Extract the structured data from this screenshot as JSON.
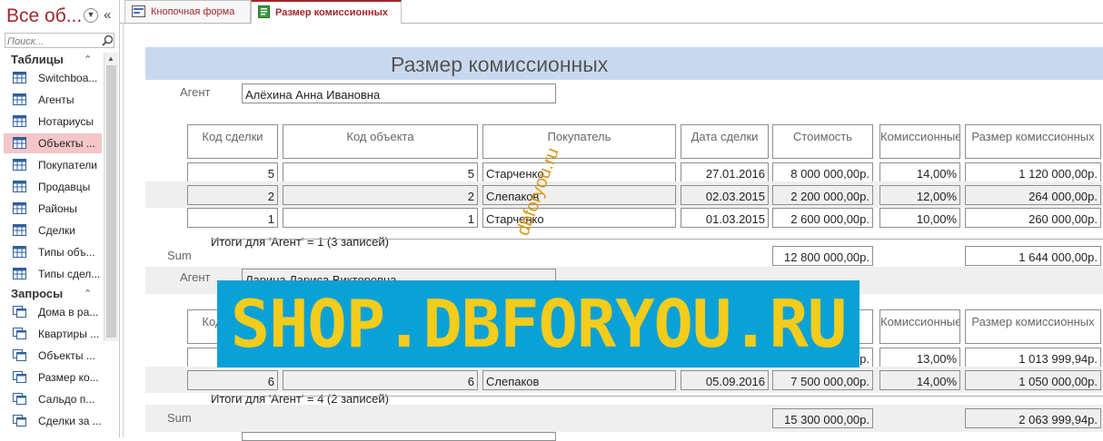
{
  "nav": {
    "title": "Все об...",
    "search_placeholder": "Поиск...",
    "sections": [
      {
        "label": "Таблицы",
        "items": [
          "Switchboa...",
          "Агенты",
          "Нотариусы",
          "Объекты ...",
          "Покупатели",
          "Продавцы",
          "Районы",
          "Сделки",
          "Типы объ...",
          "Типы сдел..."
        ]
      },
      {
        "label": "Запросы",
        "items": [
          "Дома в ра...",
          "Квартиры ...",
          "Объекты ...",
          "Размер ко...",
          "Сальдо п...",
          "Сделки за ..."
        ]
      }
    ],
    "selected_item": "Объекты ..."
  },
  "tabs": [
    {
      "label": "Кнопочная форма"
    },
    {
      "label": "Размер комиссионных"
    }
  ],
  "report": {
    "title": "Размер комиссионных",
    "agent_label": "Агент",
    "columns": [
      "Код сделки",
      "Код объекта",
      "Покупатель",
      "Дата сделки",
      "Стоимость",
      "Комиссионные",
      "Размер комиссионных"
    ],
    "sum_label": "Sum",
    "groups": [
      {
        "agent": "Алёхина Анна Ивановна",
        "rows": [
          [
            "5",
            "5",
            "Старченко",
            "27.01.2016",
            "8 000 000,00р.",
            "14,00%",
            "1 120 000,00р."
          ],
          [
            "2",
            "2",
            "Слепаков",
            "02.03.2015",
            "2 200 000,00р.",
            "12,00%",
            "264 000,00р."
          ],
          [
            "1",
            "1",
            "Старченко",
            "01.03.2015",
            "2 600 000,00р.",
            "10,00%",
            "260 000,00р."
          ]
        ],
        "totals_text": "Итоги для 'Агент' = 1 (3 записей)",
        "sum_cost": "12 800 000,00р.",
        "sum_commission": "1 644 000,00р."
      },
      {
        "agent": "Ларина Лариса Викторовна",
        "rows": [
          [
            "",
            "",
            "",
            "",
            "00р.",
            "13,00%",
            "1 013 999,94р."
          ],
          [
            "6",
            "6",
            "Слепаков",
            "05.09.2016",
            "7 500 000,00р.",
            "14,00%",
            "1 050 000,00р."
          ]
        ],
        "totals_text": "Итоги для 'Агент' = 4 (2 записей)",
        "sum_cost": "15 300 000,00р.",
        "sum_commission": "2 063 999,94р."
      }
    ]
  },
  "watermarks": {
    "banner": "SHOP.DBFORYOU.RU",
    "diagonal": "dbforyou.ru"
  }
}
